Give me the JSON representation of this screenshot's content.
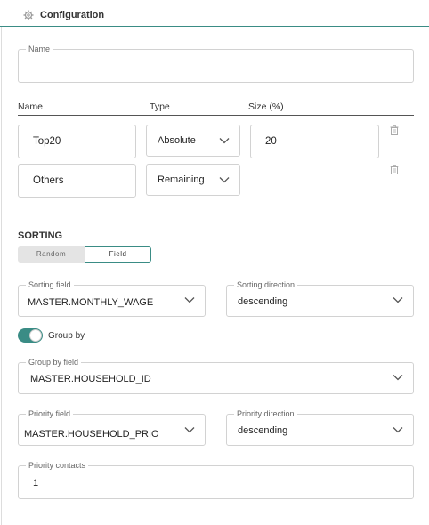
{
  "header": {
    "title": "Configuration"
  },
  "name_field": {
    "label": "Name",
    "value": ""
  },
  "groups_table": {
    "headers": {
      "name": "Name",
      "type": "Type",
      "size": "Size (%)"
    },
    "rows": [
      {
        "name": "Top20",
        "type": "Absolute",
        "size": "20"
      },
      {
        "name": "Others",
        "type": "Remaining",
        "size": ""
      }
    ]
  },
  "sorting": {
    "title": "SORTING",
    "modes": [
      "Random",
      "Field"
    ],
    "selected_mode": "Field",
    "sorting_field": {
      "label": "Sorting field",
      "value": "MASTER.MONTHLY_WAGE"
    },
    "sorting_direction": {
      "label": "Sorting direction",
      "value": "descending"
    }
  },
  "group_by": {
    "label": "Group by",
    "enabled": true,
    "field": {
      "label": "Group by field",
      "value": "MASTER.HOUSEHOLD_ID"
    }
  },
  "priority": {
    "field": {
      "label": "Priority field",
      "value": "MASTER.HOUSEHOLD_PRIO"
    },
    "direction": {
      "label": "Priority direction",
      "value": "descending"
    },
    "contacts": {
      "label": "Priority contacts",
      "value": "1"
    }
  },
  "colors": {
    "accent": "#3a8c85",
    "border": "#d2d2d2"
  }
}
